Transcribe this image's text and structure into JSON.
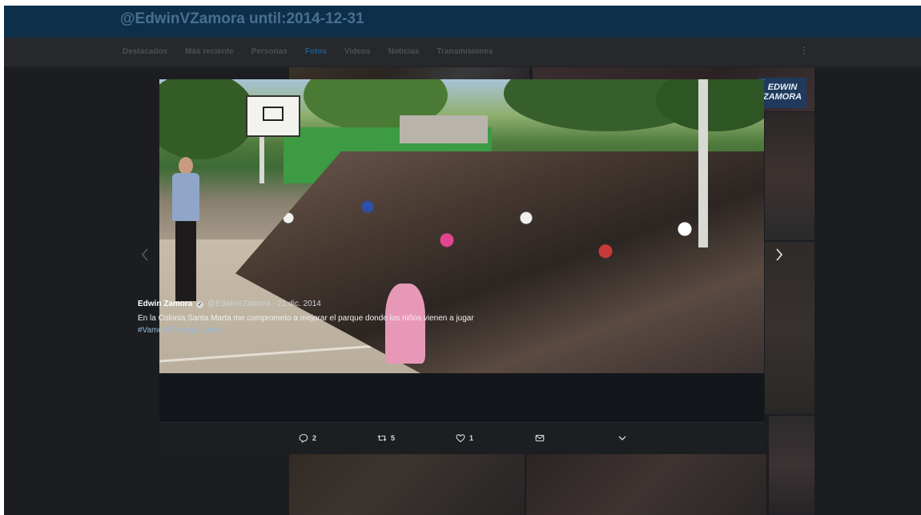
{
  "header": {
    "title": "@EdwinVZamora until:2014-12-31"
  },
  "nav": {
    "tabs": [
      "Destacados",
      "Más reciente",
      "Personas",
      "Fotos",
      "Videos",
      "Noticias",
      "Transmisiones"
    ],
    "active_tab": "Fotos",
    "more_glyph": "⋮"
  },
  "watermark": {
    "text": "EDWIN ZAMORA"
  },
  "tweet": {
    "author_name": "Edwin Zamora",
    "handle": "@EdwinVZamora",
    "date": "21 dic. 2014",
    "separator": "·",
    "text": "En la Colonia Santa Marta me comprometo a mejorar el parque donde los niños vienen a jugar ",
    "hashtag": "#VamosATrabajarJuntos",
    "replies": "2",
    "retweets": "5",
    "likes": "1"
  },
  "icons": {
    "prev": "chevron-left-icon",
    "next": "chevron-right-icon",
    "reply": "reply-icon",
    "retweet": "retweet-icon",
    "like": "heart-icon",
    "dm": "envelope-icon",
    "more": "chevron-down-icon"
  },
  "colors": {
    "header_bg": "#0d2f4a",
    "active_tab": "#1b5f8d",
    "modal_bg": "#14171a",
    "hashtag": "#9ab9d6"
  }
}
